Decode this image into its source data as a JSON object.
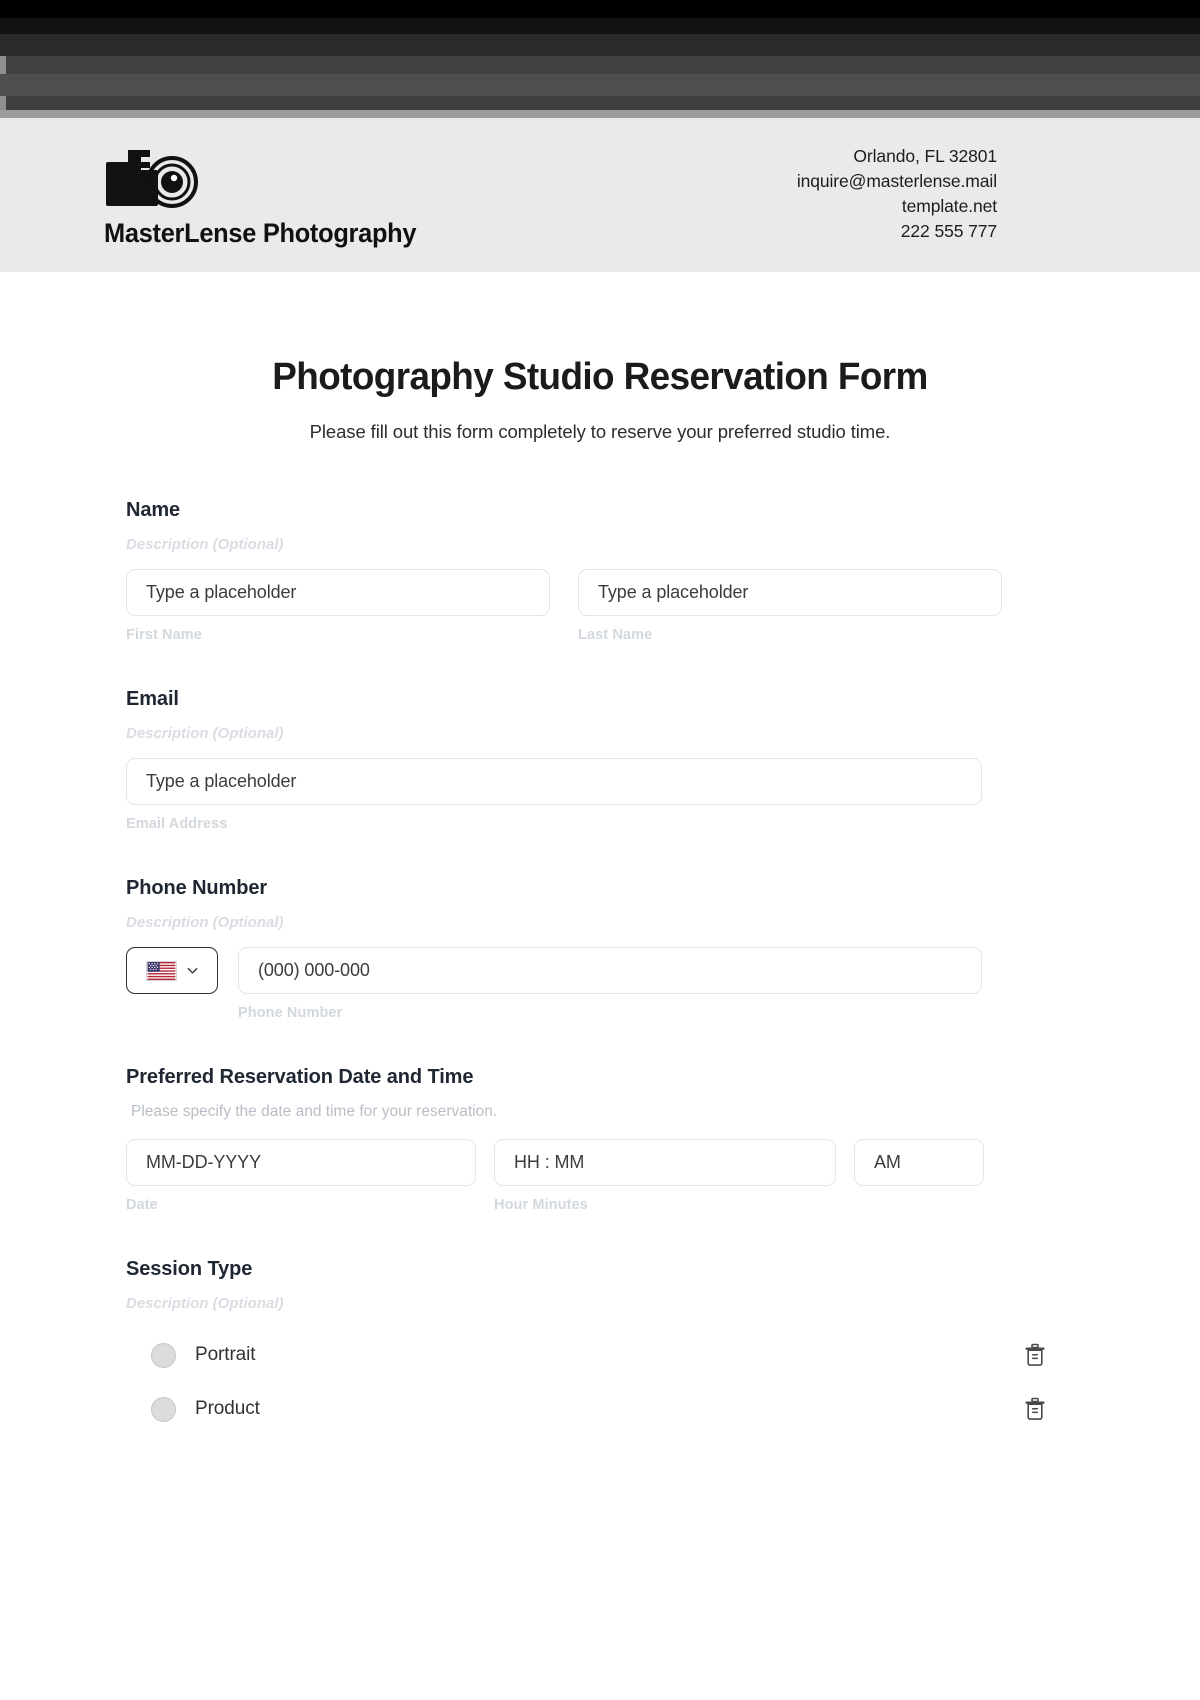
{
  "window": {
    "title_bars": [
      "#000000",
      "#131313",
      "#2b2b2b",
      "#414141",
      "#4e4e4e",
      "#3f3f3f",
      "#9b9b9b"
    ]
  },
  "letterhead": {
    "logo_icon": "camera-icon",
    "brand_name": "MasterLense Photography",
    "contact_lines": [
      "Orlando, FL 32801",
      "inquire@masterlense.mail",
      "template.net",
      "222 555 777"
    ]
  },
  "form": {
    "title": "Photography Studio Reservation Form",
    "subtitle": "Please fill out this form completely to reserve your preferred studio time.",
    "fields": {
      "name": {
        "legend": "Name",
        "description": "Description (Optional)",
        "first": {
          "placeholder": "Type a placeholder",
          "sub_label": "First Name"
        },
        "last": {
          "placeholder": "Type a placeholder",
          "sub_label": "Last Name"
        }
      },
      "email": {
        "legend": "Email",
        "description": "Description (Optional)",
        "input": {
          "placeholder": "Type a placeholder",
          "sub_label": "Email Address"
        }
      },
      "phone": {
        "legend": "Phone Number",
        "description": "Description (Optional)",
        "country_icon": "us-flag-icon",
        "chevron_icon": "chevron-down-icon",
        "input": {
          "placeholder": "(000) 000-000",
          "sub_label": "Phone Number"
        }
      },
      "datetime": {
        "legend": "Preferred Reservation Date and Time",
        "description": "Please specify the date and time for your reservation.",
        "date": {
          "placeholder": "MM-DD-YYYY",
          "sub_label": "Date"
        },
        "time": {
          "placeholder": "HH : MM",
          "sub_label": "Hour Minutes"
        },
        "meridiem": {
          "value": "AM"
        }
      },
      "session_type": {
        "legend": "Session Type",
        "description": "Description (Optional)",
        "options": [
          {
            "label": "Portrait",
            "delete_icon": "trash-icon"
          },
          {
            "label": "Product",
            "delete_icon": "trash-icon"
          }
        ]
      }
    }
  },
  "colors": {
    "letterhead_bg": "#eaeaea",
    "border": "#e3e6ea",
    "border_active": "#2f2f2f",
    "muted_label": "#d3d8de",
    "text": "#1f2733"
  }
}
